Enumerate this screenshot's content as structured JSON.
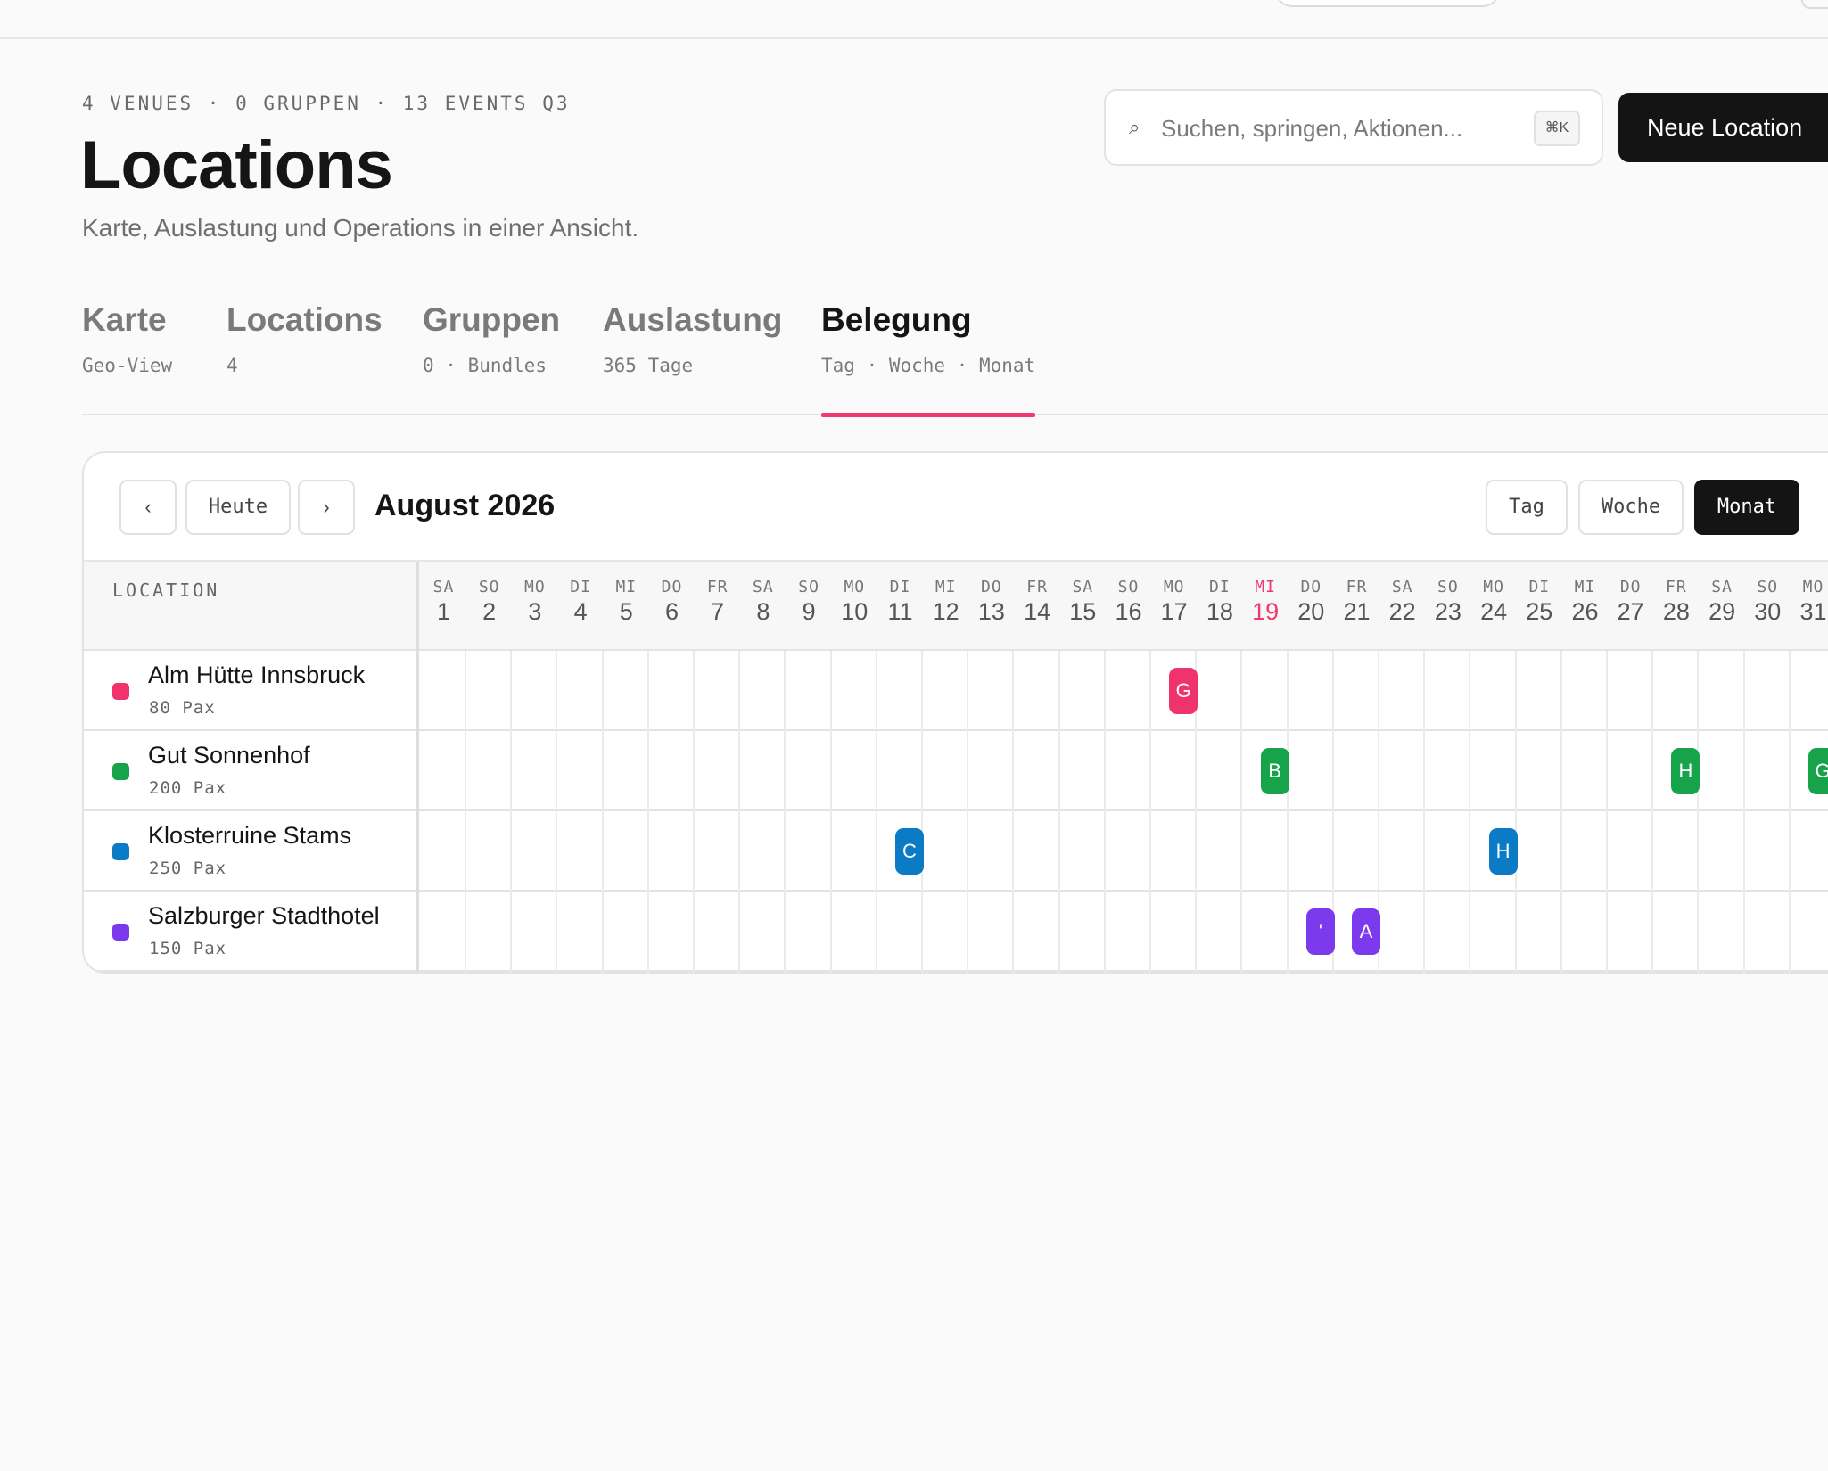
{
  "header": {
    "meta": "4 VENUES · 0 GRUPPEN · 13 EVENTS Q3",
    "title": "Locations",
    "subtitle": "Karte, Auslastung und Operations in einer Ansicht."
  },
  "search": {
    "placeholder": "Suchen, springen, Aktionen...",
    "shortcut": "⌘K",
    "icon": "search-icon"
  },
  "new_button": "Neue Location",
  "tabs": [
    {
      "label": "Karte",
      "sub": "Geo-View"
    },
    {
      "label": "Locations",
      "sub": "4"
    },
    {
      "label": "Gruppen",
      "sub": "0 · Bundles"
    },
    {
      "label": "Auslastung",
      "sub": "365 Tage"
    },
    {
      "label": "Belegung",
      "sub": "Tag · Woche · Monat",
      "active": true
    }
  ],
  "calendar": {
    "prev": "‹",
    "today": "Heute",
    "next": "›",
    "month": "August 2026",
    "views": [
      "Tag",
      "Woche",
      "Monat"
    ],
    "active_view": "Monat",
    "location_header": "LOCATION",
    "today_day": 19,
    "days": [
      {
        "w": "SA",
        "d": "1"
      },
      {
        "w": "SO",
        "d": "2"
      },
      {
        "w": "MO",
        "d": "3"
      },
      {
        "w": "DI",
        "d": "4"
      },
      {
        "w": "MI",
        "d": "5"
      },
      {
        "w": "DO",
        "d": "6"
      },
      {
        "w": "FR",
        "d": "7"
      },
      {
        "w": "SA",
        "d": "8"
      },
      {
        "w": "SO",
        "d": "9"
      },
      {
        "w": "MO",
        "d": "10"
      },
      {
        "w": "DI",
        "d": "11"
      },
      {
        "w": "MI",
        "d": "12"
      },
      {
        "w": "DO",
        "d": "13"
      },
      {
        "w": "FR",
        "d": "14"
      },
      {
        "w": "SA",
        "d": "15"
      },
      {
        "w": "SO",
        "d": "16"
      },
      {
        "w": "MO",
        "d": "17"
      },
      {
        "w": "DI",
        "d": "18"
      },
      {
        "w": "MI",
        "d": "19"
      },
      {
        "w": "DO",
        "d": "20"
      },
      {
        "w": "FR",
        "d": "21"
      },
      {
        "w": "SA",
        "d": "22"
      },
      {
        "w": "SO",
        "d": "23"
      },
      {
        "w": "MO",
        "d": "24"
      },
      {
        "w": "DI",
        "d": "25"
      },
      {
        "w": "MI",
        "d": "26"
      },
      {
        "w": "DO",
        "d": "27"
      },
      {
        "w": "FR",
        "d": "28"
      },
      {
        "w": "SA",
        "d": "29"
      },
      {
        "w": "SO",
        "d": "30"
      },
      {
        "w": "MO",
        "d": "31"
      }
    ],
    "locations": [
      {
        "name": "Alm Hütte Innsbruck",
        "pax": "80 Pax",
        "color": "#f0336c",
        "events": [
          {
            "day": 17,
            "label": "G"
          }
        ]
      },
      {
        "name": "Gut Sonnenhof",
        "pax": "200 Pax",
        "color": "#16a34a",
        "events": [
          {
            "day": 19,
            "label": "B"
          },
          {
            "day": 28,
            "label": "H"
          },
          {
            "day": 31,
            "label": "G"
          }
        ]
      },
      {
        "name": "Klosterruine Stams",
        "pax": "250 Pax",
        "color": "#0a7bc4",
        "events": [
          {
            "day": 11,
            "label": "C"
          },
          {
            "day": 24,
            "label": "H"
          }
        ]
      },
      {
        "name": "Salzburger Stadthotel",
        "pax": "150 Pax",
        "color": "#7c3aed",
        "events": [
          {
            "day": 20,
            "label": "'"
          },
          {
            "day": 21,
            "label": "A"
          }
        ]
      }
    ]
  }
}
